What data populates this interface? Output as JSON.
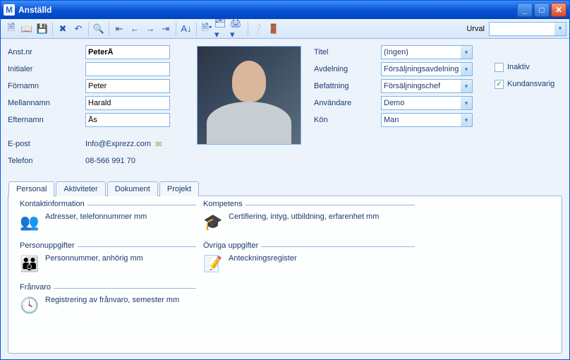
{
  "window": {
    "title": "Anställd",
    "app_letter": "M"
  },
  "toolbar": {
    "urval_label": "Urval"
  },
  "fields": {
    "anstnr_label": "Anst.nr",
    "anstnr": "PeterÅ",
    "initialer_label": "Initialer",
    "initialer": "",
    "fornamn_label": "Förnamn",
    "fornamn": "Peter",
    "mellannamn_label": "Mellannamn",
    "mellannamn": "Harald",
    "efternamn_label": "Efternamn",
    "efternamn": "Ås",
    "epost_label": "E-post",
    "epost": "Info@Exprezz.com",
    "telefon_label": "Telefon",
    "telefon": "08-566 991 70"
  },
  "right_fields": {
    "titel_label": "Titel",
    "titel": "(Ingen)",
    "avdelning_label": "Avdelning",
    "avdelning": "Försäljningsavdelning",
    "befattning_label": "Befattning",
    "befattning": "Försäljningschef",
    "anvandare_label": "Användare",
    "anvandare": "Demo",
    "kon_label": "Kön",
    "kon": "Man"
  },
  "checks": {
    "inaktiv_label": "Inaktiv",
    "inaktiv_checked": "",
    "kundansvarig_label": "Kundansvarig",
    "kundansvarig_checked": "✓"
  },
  "tabs": {
    "t0": "Personal",
    "t1": "Aktiviteter",
    "t2": "Dokument",
    "t3": "Projekt"
  },
  "groups": {
    "kontakt_title": "Kontaktinformation",
    "kontakt_text": "Adresser, telefonnummer mm",
    "kontakt_icon": "👥",
    "kompetens_title": "Kompetens",
    "kompetens_text": "Certifiering, intyg, utbildning, erfarenhet mm",
    "kompetens_icon": "🎓",
    "person_title": "Personuppgifter",
    "person_text": "Personnummer, anhörig mm",
    "person_icon": "👪",
    "ovriga_title": "Övriga uppgifter",
    "ovriga_text": "Anteckningsregister",
    "ovriga_icon": "📝",
    "franvaro_title": "Frånvaro",
    "franvaro_text": "Registrering av frånvaro, semester mm",
    "franvaro_icon": "🕓"
  }
}
